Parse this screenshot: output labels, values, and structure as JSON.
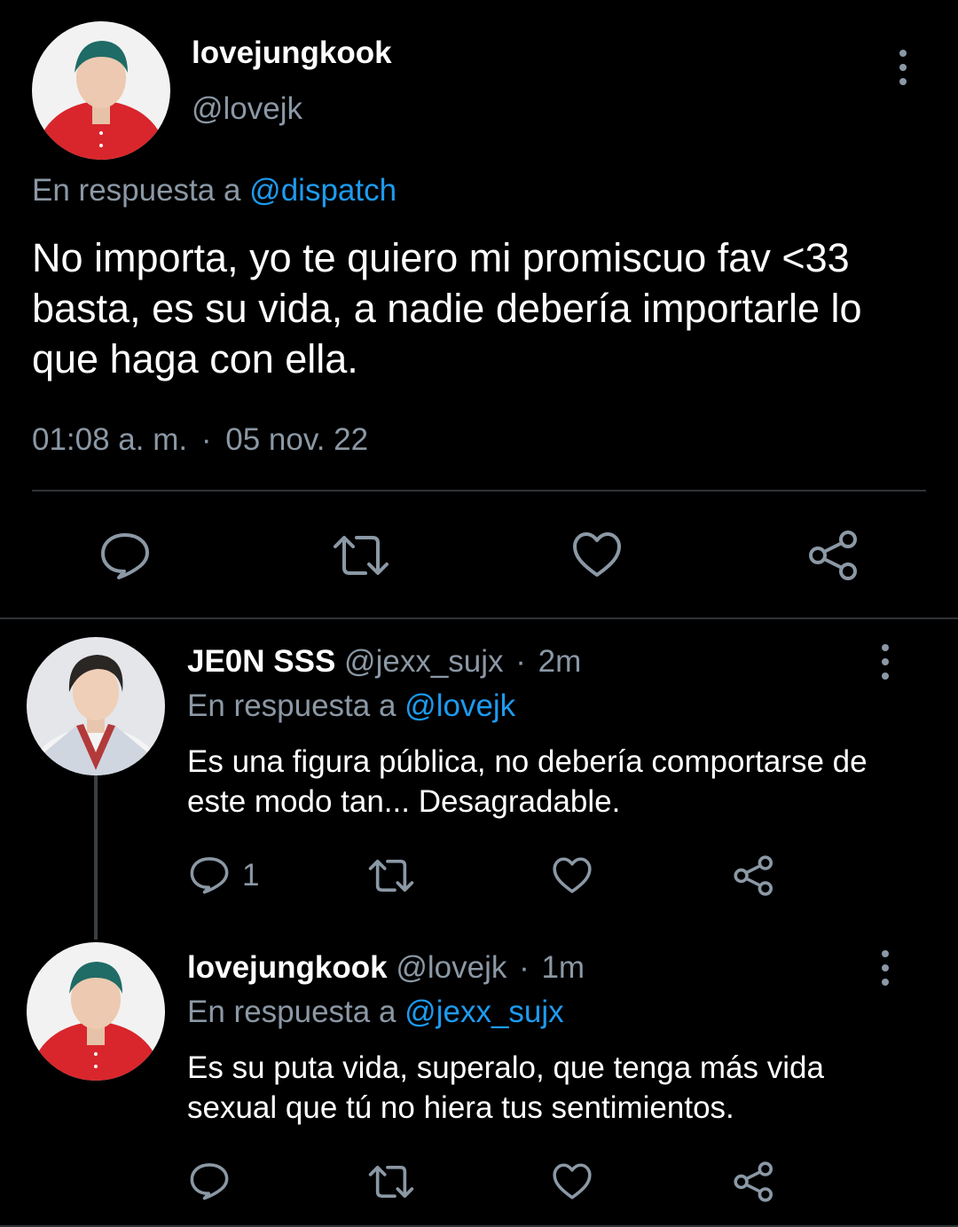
{
  "main_tweet": {
    "display_name": "lovejungkook",
    "handle": "@lovejk",
    "reply_prefix": "En respuesta a",
    "reply_mention": "@dispatch",
    "text": "No importa, yo te quiero mi promiscuo fav <33 basta, es su vida, a nadie debería importarle lo que haga con ella.",
    "time": "01:08 a. m.",
    "separator": "·",
    "date": "05 nov. 22"
  },
  "replies": [
    {
      "display_name": "JE0N SSS",
      "handle": "@jexx_sujx",
      "separator": "·",
      "age": "2m",
      "reply_prefix": "En respuesta a",
      "reply_mention": "@lovejk",
      "text": "Es una figura pública, no debería comportarse de este modo tan... Desagradable.",
      "reply_count": "1"
    },
    {
      "display_name": "lovejungkook",
      "handle": "@lovejk",
      "separator": "·",
      "age": "1m",
      "reply_prefix": "En respuesta a",
      "reply_mention": "@jexx_sujx",
      "text": "Es su puta vida, superalo, que tenga más vida sexual que tú no hiera tus sentimientos."
    }
  ],
  "icons": {
    "reply": "speech-bubble-icon",
    "retweet": "retweet-arrows-icon",
    "like": "heart-icon",
    "share": "share-nodes-icon",
    "more": "vertical-ellipsis-icon"
  },
  "colors": {
    "background": "#000000",
    "text_primary": "#ffffff",
    "text_secondary": "#8b98a5",
    "mention": "#1d9bf0",
    "divider": "#2f3336"
  }
}
